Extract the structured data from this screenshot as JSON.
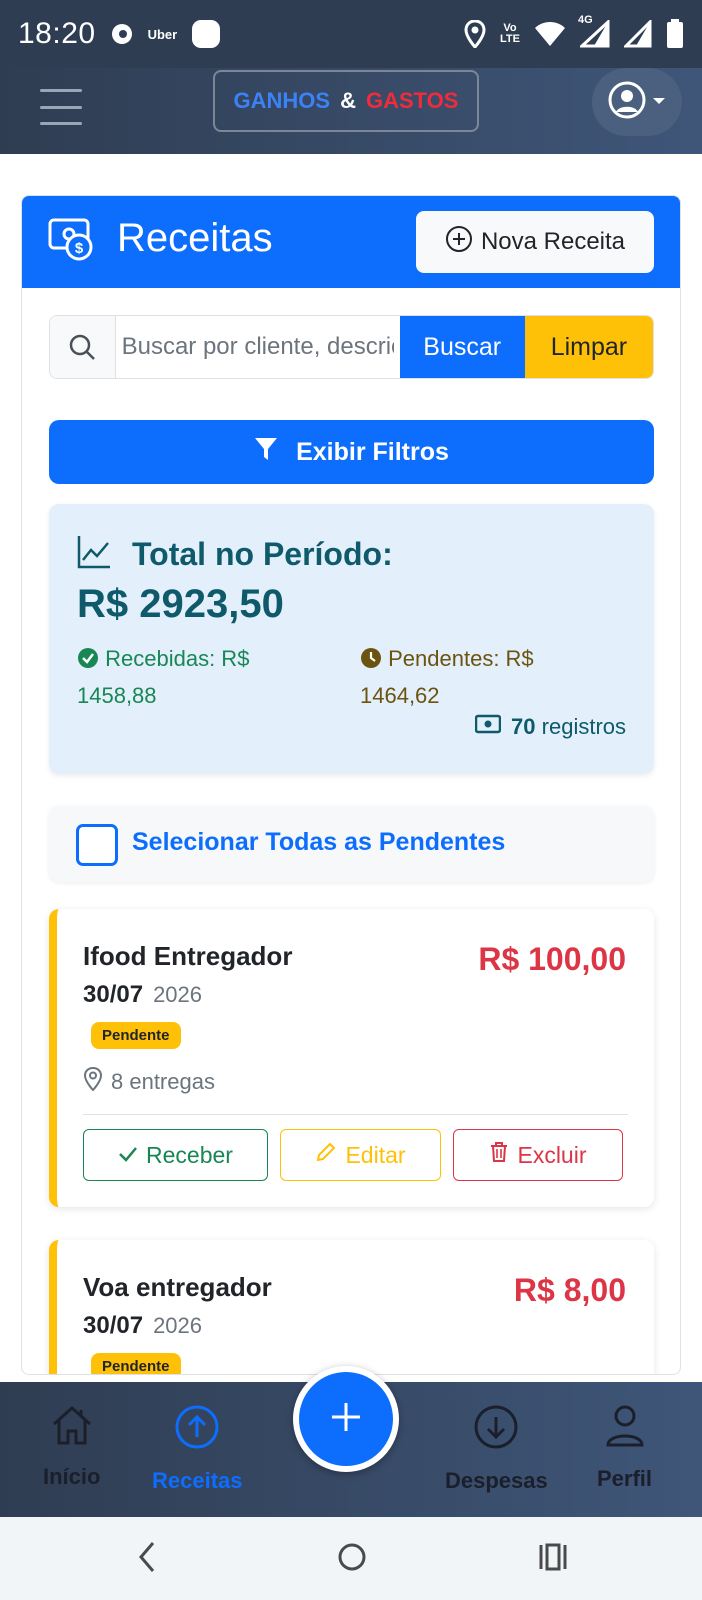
{
  "status_bar": {
    "time": "18:20",
    "app_label": "Uber",
    "volte_top": "Vo",
    "volte_bottom": "LTE",
    "network": "4G"
  },
  "navbar": {
    "brand_part1": "GANHOS",
    "brand_part2": "&",
    "brand_part3": "GASTOS"
  },
  "page": {
    "title": "Receitas",
    "new_button": "Nova Receita"
  },
  "search": {
    "placeholder": "Buscar por cliente, descrição...",
    "search_button": "Buscar",
    "clear_button": "Limpar"
  },
  "filters": {
    "toggle_label": "Exibir Filtros"
  },
  "summary": {
    "title": "Total no Período:",
    "total": "R$ 2923,50",
    "received_label": "Recebidas: R$",
    "received_value": "1458,88",
    "pending_label": "Pendentes: R$",
    "pending_value": "1464,62",
    "records_count": "70",
    "records_label": "registros"
  },
  "select_all": {
    "label": "Selecionar Todas as Pendentes"
  },
  "entries": [
    {
      "name": "Ifood Entregador",
      "date": "30/07",
      "year": "2026",
      "amount": "R$ 100,00",
      "status": "Pendente",
      "location": "8 entregas",
      "actions": {
        "receive": "Receber",
        "edit": "Editar",
        "delete": "Excluir"
      }
    },
    {
      "name": "Voa entregador",
      "date": "30/07",
      "year": "2026",
      "amount": "R$ 8,00",
      "status": "Pendente"
    }
  ],
  "bottom_nav": {
    "home": "Início",
    "income": "Receitas",
    "expenses": "Despesas",
    "profile": "Perfil",
    "active": "income"
  },
  "colors": {
    "primary": "#0d6efd",
    "warning": "#ffc107",
    "success": "#198754",
    "danger": "#dc3545",
    "navbar": "#2f3d52"
  }
}
